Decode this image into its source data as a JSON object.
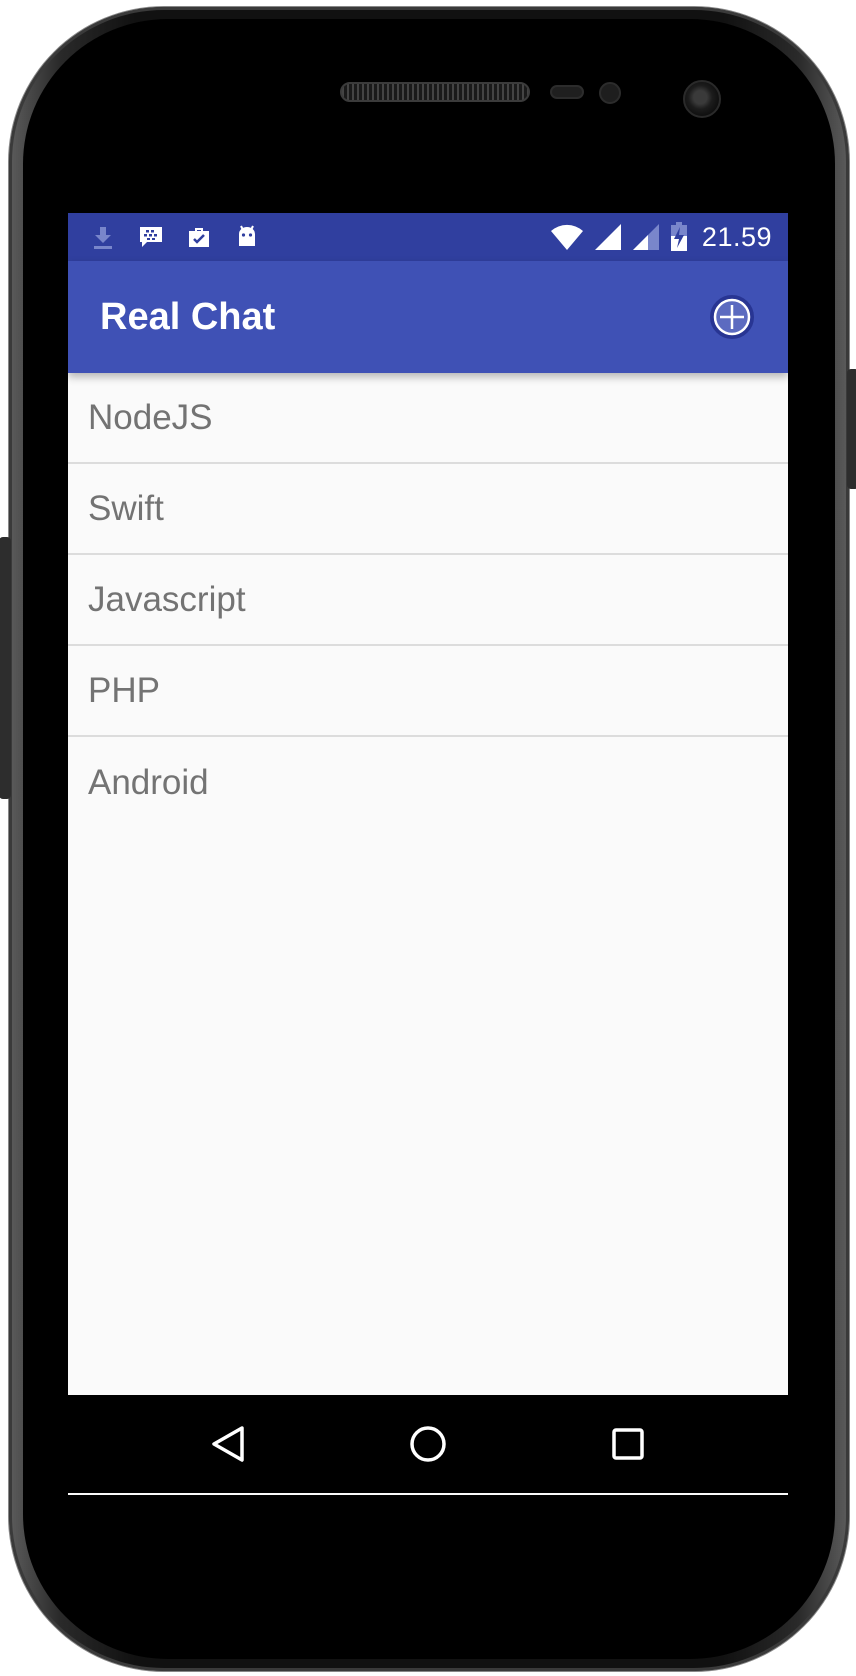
{
  "status_bar": {
    "time": "21.59",
    "left_icons": [
      "download-icon",
      "bbm-icon",
      "work-briefcase-icon",
      "android-icon"
    ],
    "right_icons": [
      "wifi-icon",
      "signal-full-icon",
      "signal-partial-icon",
      "battery-charging-icon"
    ]
  },
  "app_bar": {
    "title": "Real Chat",
    "action_icon": "add-circle-icon"
  },
  "rooms": [
    {
      "label": "NodeJS"
    },
    {
      "label": "Swift"
    },
    {
      "label": "Javascript"
    },
    {
      "label": "PHP"
    },
    {
      "label": "Android"
    }
  ],
  "nav_bar": {
    "buttons": [
      "back-icon",
      "home-icon",
      "recents-icon"
    ]
  },
  "colors": {
    "primary": "#3f51b5",
    "primary_dark": "#303f9f",
    "background": "#fafafa",
    "item_text": "#737373"
  }
}
